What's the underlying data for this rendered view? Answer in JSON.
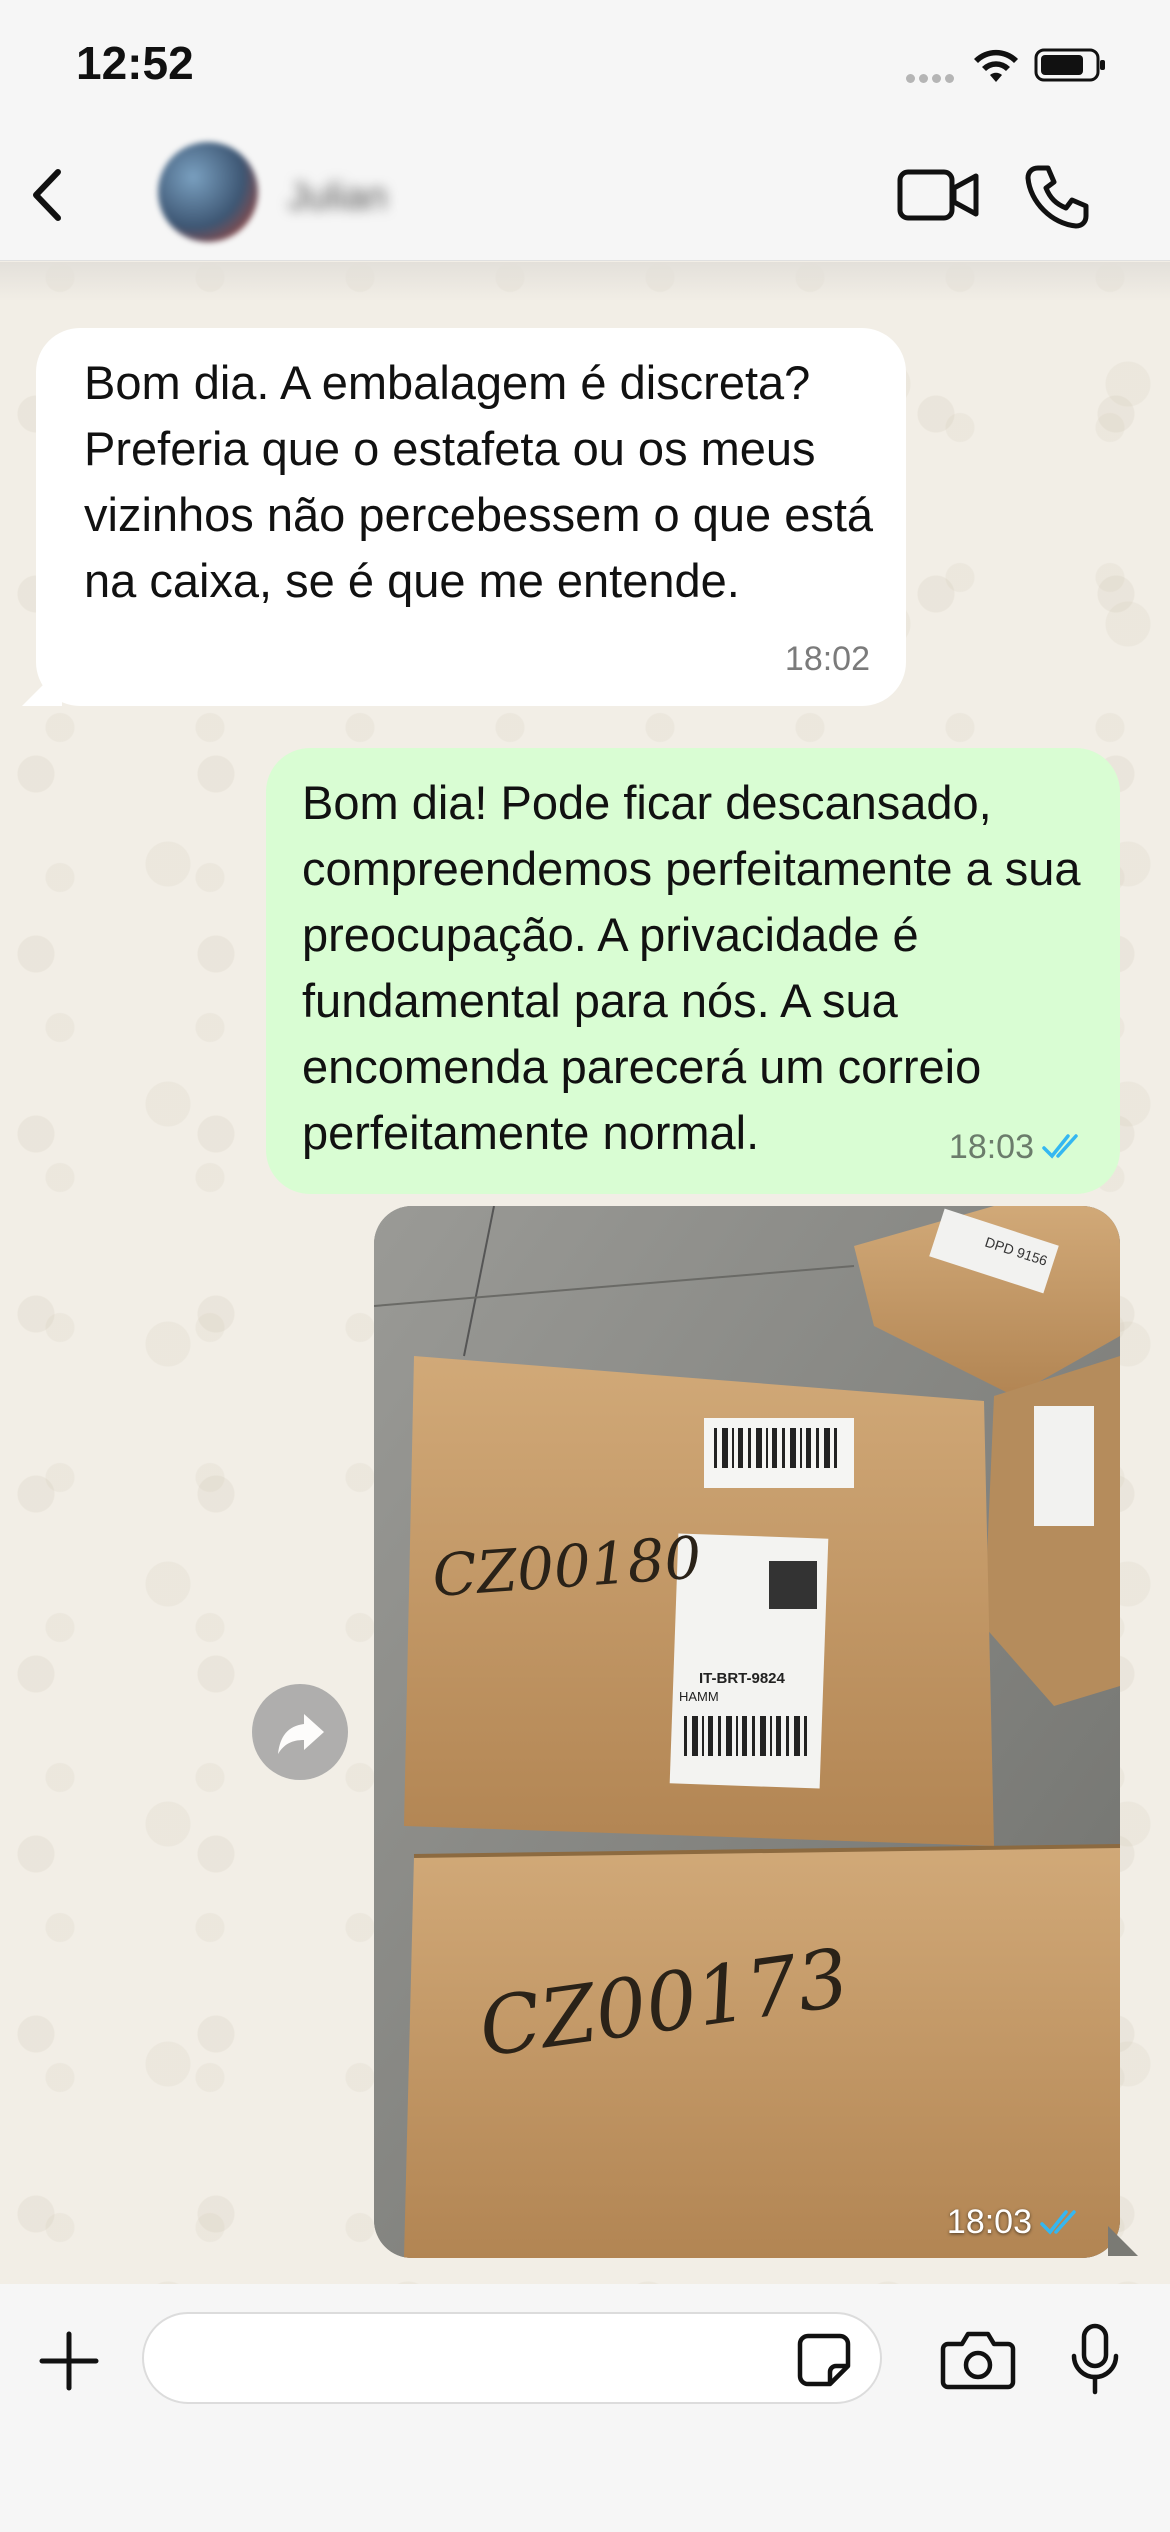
{
  "status_bar": {
    "time": "12:52"
  },
  "header": {
    "contact_name": "Julian",
    "icons": {
      "back": "chevron-left-icon",
      "video": "video-camera-icon",
      "call": "phone-icon"
    }
  },
  "messages": [
    {
      "direction": "incoming",
      "text": "Bom dia. A embalagem é discreta? Preferia que o estafeta ou os meus vizinhos não percebessem o que está na caixa, se é que me entende.",
      "time": "18:02"
    },
    {
      "direction": "outgoing",
      "text": "Bom dia! Pode ficar descansado, compreendemos perfeitamente a sua preocupação. A privacidade é fundamental para nós. A sua encomenda parecerá um correio perfeitamente normal.",
      "time": "18:03",
      "read": true
    },
    {
      "direction": "outgoing",
      "type": "image",
      "image_labels": {
        "box1_handwriting": "CZ00180",
        "box1_label": "IT-BRT-9824",
        "box1_label_sub": "HAMM",
        "box2_handwriting": "CZ00173",
        "corner_label": "DPD 9156"
      },
      "time": "18:03",
      "read": true
    }
  ],
  "composer": {
    "placeholder": "",
    "icons": {
      "plus": "plus-icon",
      "sticker": "sticker-icon",
      "camera": "camera-icon",
      "mic": "microphone-icon"
    }
  },
  "colors": {
    "outgoing_bubble": "#d9fdd3",
    "incoming_bubble": "#ffffff",
    "read_ticks": "#34b7f1",
    "background": "#f2eee6"
  }
}
